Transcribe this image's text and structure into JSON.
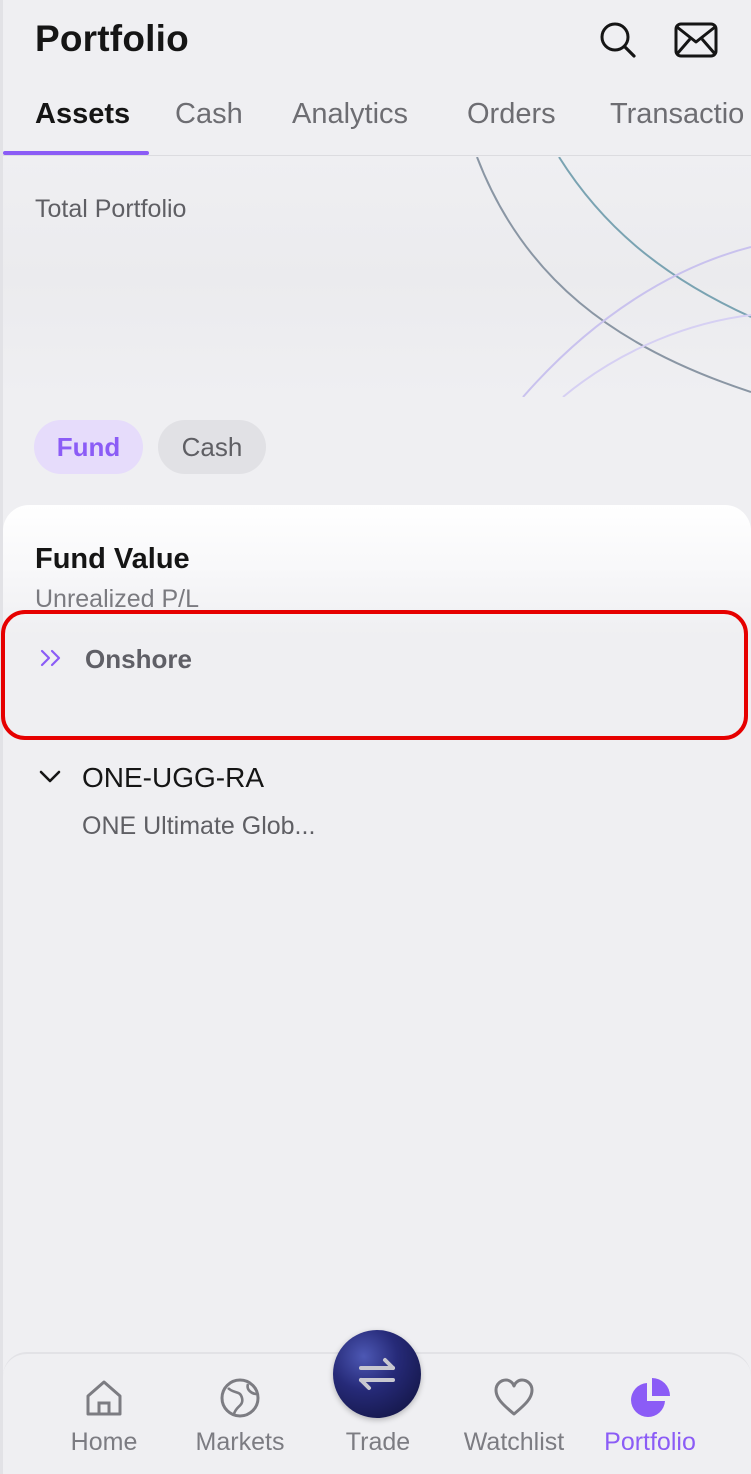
{
  "header": {
    "title": "Portfolio",
    "search_icon": "search-icon",
    "mail_icon": "mail-icon"
  },
  "tabs": [
    {
      "label": "Assets",
      "active": true
    },
    {
      "label": "Cash",
      "active": false
    },
    {
      "label": "Analytics",
      "active": false
    },
    {
      "label": "Orders",
      "active": false
    },
    {
      "label": "Transactio",
      "active": false
    }
  ],
  "hero": {
    "label": "Total Portfolio"
  },
  "filters": {
    "fund": "Fund",
    "cash": "Cash",
    "selected": "Fund"
  },
  "fund_card": {
    "title": "Fund Value",
    "subtitle": "Unrealized P/L",
    "section": "Onshore",
    "items": [
      {
        "code": "ONE-UGG-RA",
        "name": "ONE Ultimate Glob..."
      }
    ]
  },
  "bottom_nav": {
    "items": [
      {
        "label": "Home",
        "icon": "home-icon"
      },
      {
        "label": "Markets",
        "icon": "globe-icon"
      },
      {
        "label": "Trade",
        "icon": "swap-icon"
      },
      {
        "label": "Watchlist",
        "icon": "heart-icon"
      },
      {
        "label": "Portfolio",
        "icon": "pie-chart-icon",
        "active": true
      }
    ]
  },
  "colors": {
    "accent": "#8b5cf6",
    "highlight_border": "#e60000",
    "background": "#efeff2"
  }
}
